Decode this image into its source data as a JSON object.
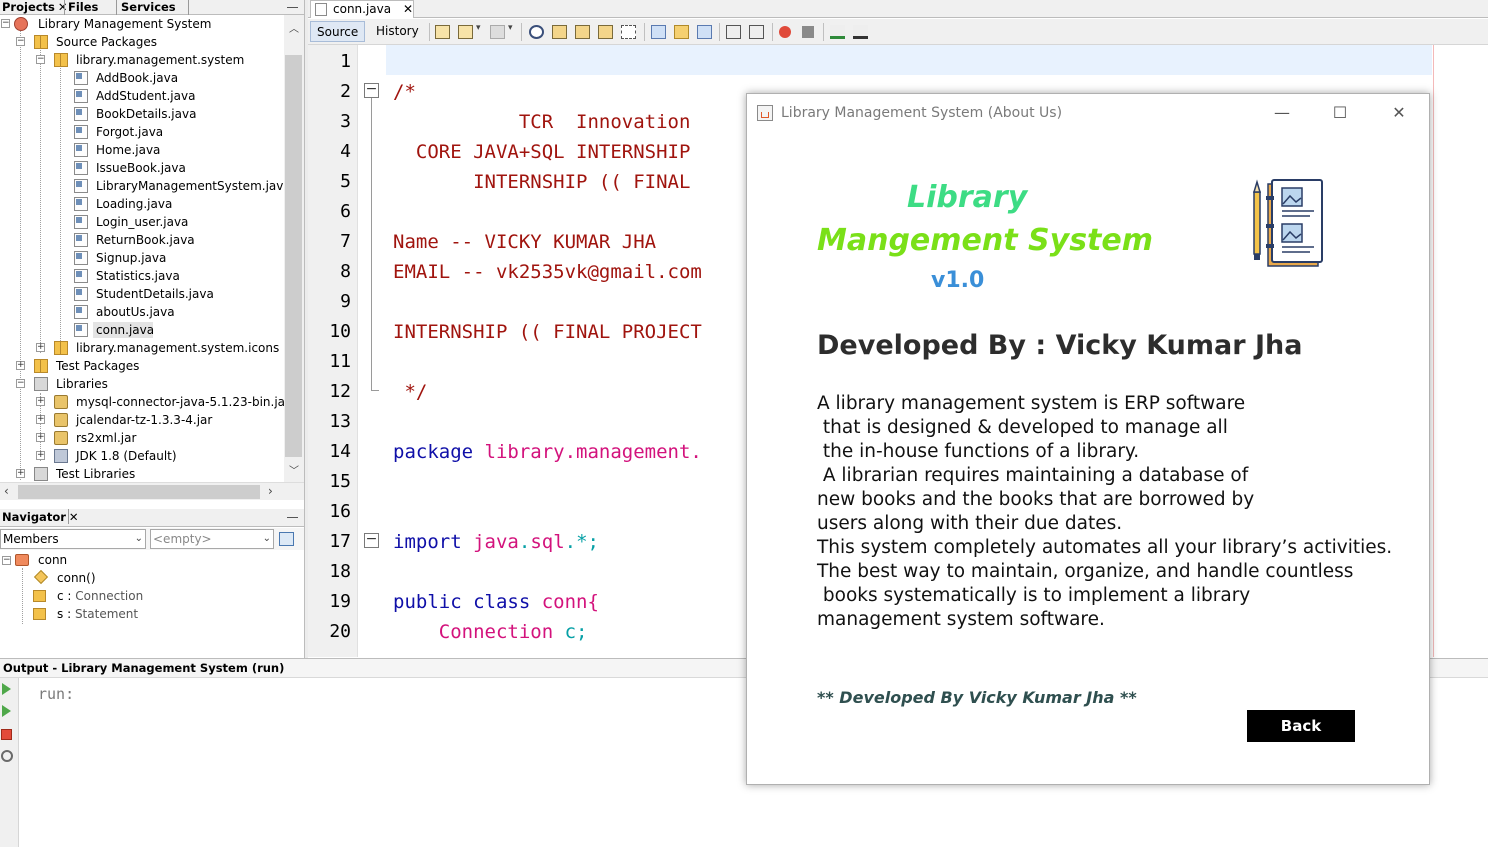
{
  "left_panel": {
    "tabs": [
      {
        "label": "Projects",
        "close": "✕"
      },
      {
        "label": "Files"
      },
      {
        "label": "Services"
      }
    ],
    "tree": [
      {
        "label": "Library Management System",
        "level": 0,
        "icon": "project-icon"
      },
      {
        "label": "Source Packages",
        "level": 1,
        "icon": "source-packages-icon"
      },
      {
        "label": "library.management.system",
        "level": 2,
        "icon": "package-icon"
      },
      {
        "label": "AddBook.java",
        "level": 3,
        "icon": "java-file-icon"
      },
      {
        "label": "AddStudent.java",
        "level": 3,
        "icon": "java-file-icon"
      },
      {
        "label": "BookDetails.java",
        "level": 3,
        "icon": "java-file-icon"
      },
      {
        "label": "Forgot.java",
        "level": 3,
        "icon": "java-file-icon"
      },
      {
        "label": "Home.java",
        "level": 3,
        "icon": "java-file-icon"
      },
      {
        "label": "IssueBook.java",
        "level": 3,
        "icon": "java-file-icon"
      },
      {
        "label": "LibraryManagementSystem.java",
        "level": 3,
        "icon": "java-file-icon"
      },
      {
        "label": "Loading.java",
        "level": 3,
        "icon": "java-file-icon"
      },
      {
        "label": "Login_user.java",
        "level": 3,
        "icon": "java-file-icon"
      },
      {
        "label": "ReturnBook.java",
        "level": 3,
        "icon": "java-file-icon"
      },
      {
        "label": "Signup.java",
        "level": 3,
        "icon": "java-file-icon"
      },
      {
        "label": "Statistics.java",
        "level": 3,
        "icon": "java-file-icon"
      },
      {
        "label": "StudentDetails.java",
        "level": 3,
        "icon": "java-file-icon"
      },
      {
        "label": "aboutUs.java",
        "level": 3,
        "icon": "java-file-icon"
      },
      {
        "label": "conn.java",
        "level": 3,
        "icon": "java-file-icon"
      },
      {
        "label": "library.management.system.icons",
        "level": 2,
        "icon": "package-icon"
      },
      {
        "label": "Test Packages",
        "level": 1,
        "icon": "test-packages-icon"
      },
      {
        "label": "Libraries",
        "level": 1,
        "icon": "libraries-icon"
      },
      {
        "label": "mysql-connector-java-5.1.23-bin.jar",
        "level": 2,
        "icon": "jar-icon"
      },
      {
        "label": "jcalendar-tz-1.3.3-4.jar",
        "level": 2,
        "icon": "jar-icon"
      },
      {
        "label": "rs2xml.jar",
        "level": 2,
        "icon": "jar-icon"
      },
      {
        "label": "JDK 1.8 (Default)",
        "level": 2,
        "icon": "jdk-icon"
      },
      {
        "label": "Test Libraries",
        "level": 1,
        "icon": "libraries-icon"
      }
    ],
    "navigator": {
      "tab_label": "Navigator",
      "close": "✕",
      "members_label": "Members",
      "filter_placeholder": "<empty>",
      "root_label": "conn",
      "items": [
        {
          "name": "conn()",
          "type": ""
        },
        {
          "name": "c",
          "type": "Connection"
        },
        {
          "name": "s",
          "type": "Statement"
        }
      ]
    }
  },
  "editor": {
    "tab_label": "conn.java",
    "tab_close": "✕",
    "source_label": "Source",
    "history_label": "History",
    "line_numbers": [
      "1",
      "2",
      "3",
      "4",
      "5",
      "6",
      "7",
      "8",
      "9",
      "10",
      "11",
      "12",
      "13",
      "14",
      "15",
      "16",
      "17",
      "18",
      "19",
      "20"
    ],
    "lines": {
      "l2": "/*",
      "l3": "           TCR  Innovation",
      "l4": "  CORE JAVA+SQL INTERNSHIP",
      "l5": "       INTERNSHIP (( FINAL",
      "l7": "Name -- VICKY KUMAR JHA",
      "l8": "EMAIL -- vk2535vk@gmail.com",
      "l10": "INTERNSHIP (( FINAL PROJECT",
      "l12": " */",
      "package_kw": "package",
      "package_name": "library.management.",
      "import_kw": "import",
      "import_a": "java",
      "import_dot": ".",
      "import_b": "sql",
      "import_rest": ".*;",
      "public_kw": "public class",
      "class_name": "conn{",
      "field_type": "Connection",
      "field_name": "c;"
    }
  },
  "output": {
    "title": "Output - Library Management System (run)",
    "text": "run:"
  },
  "dialog": {
    "title": "Library Management System (About Us)",
    "window_controls": {
      "minimize": "—",
      "maximize": "☐",
      "close": "✕"
    },
    "heading_line1": "Library",
    "heading_line2": "Mangement System",
    "version": "v1.0",
    "developed_by": "Developed By : Vicky Kumar Jha",
    "description": "A library management system is ERP software\n that is designed & developed to manage all\n the in-house functions of a library.\n A librarian requires maintaining a database of\nnew books and the books that are borrowed by\nusers along with their due dates.\nThis system completely automates all your library’s activities.\nThe best way to maintain, organize, and handle countless\n books systematically is to implement a library\nmanagement system software.",
    "footer": "** Developed By Vicky Kumar Jha **",
    "back_label": "Back",
    "colors": {
      "heading_line1": "#3ddc84",
      "heading_line2": "#7ae018",
      "version": "#3a8fd8",
      "back_button": "#000000"
    }
  }
}
